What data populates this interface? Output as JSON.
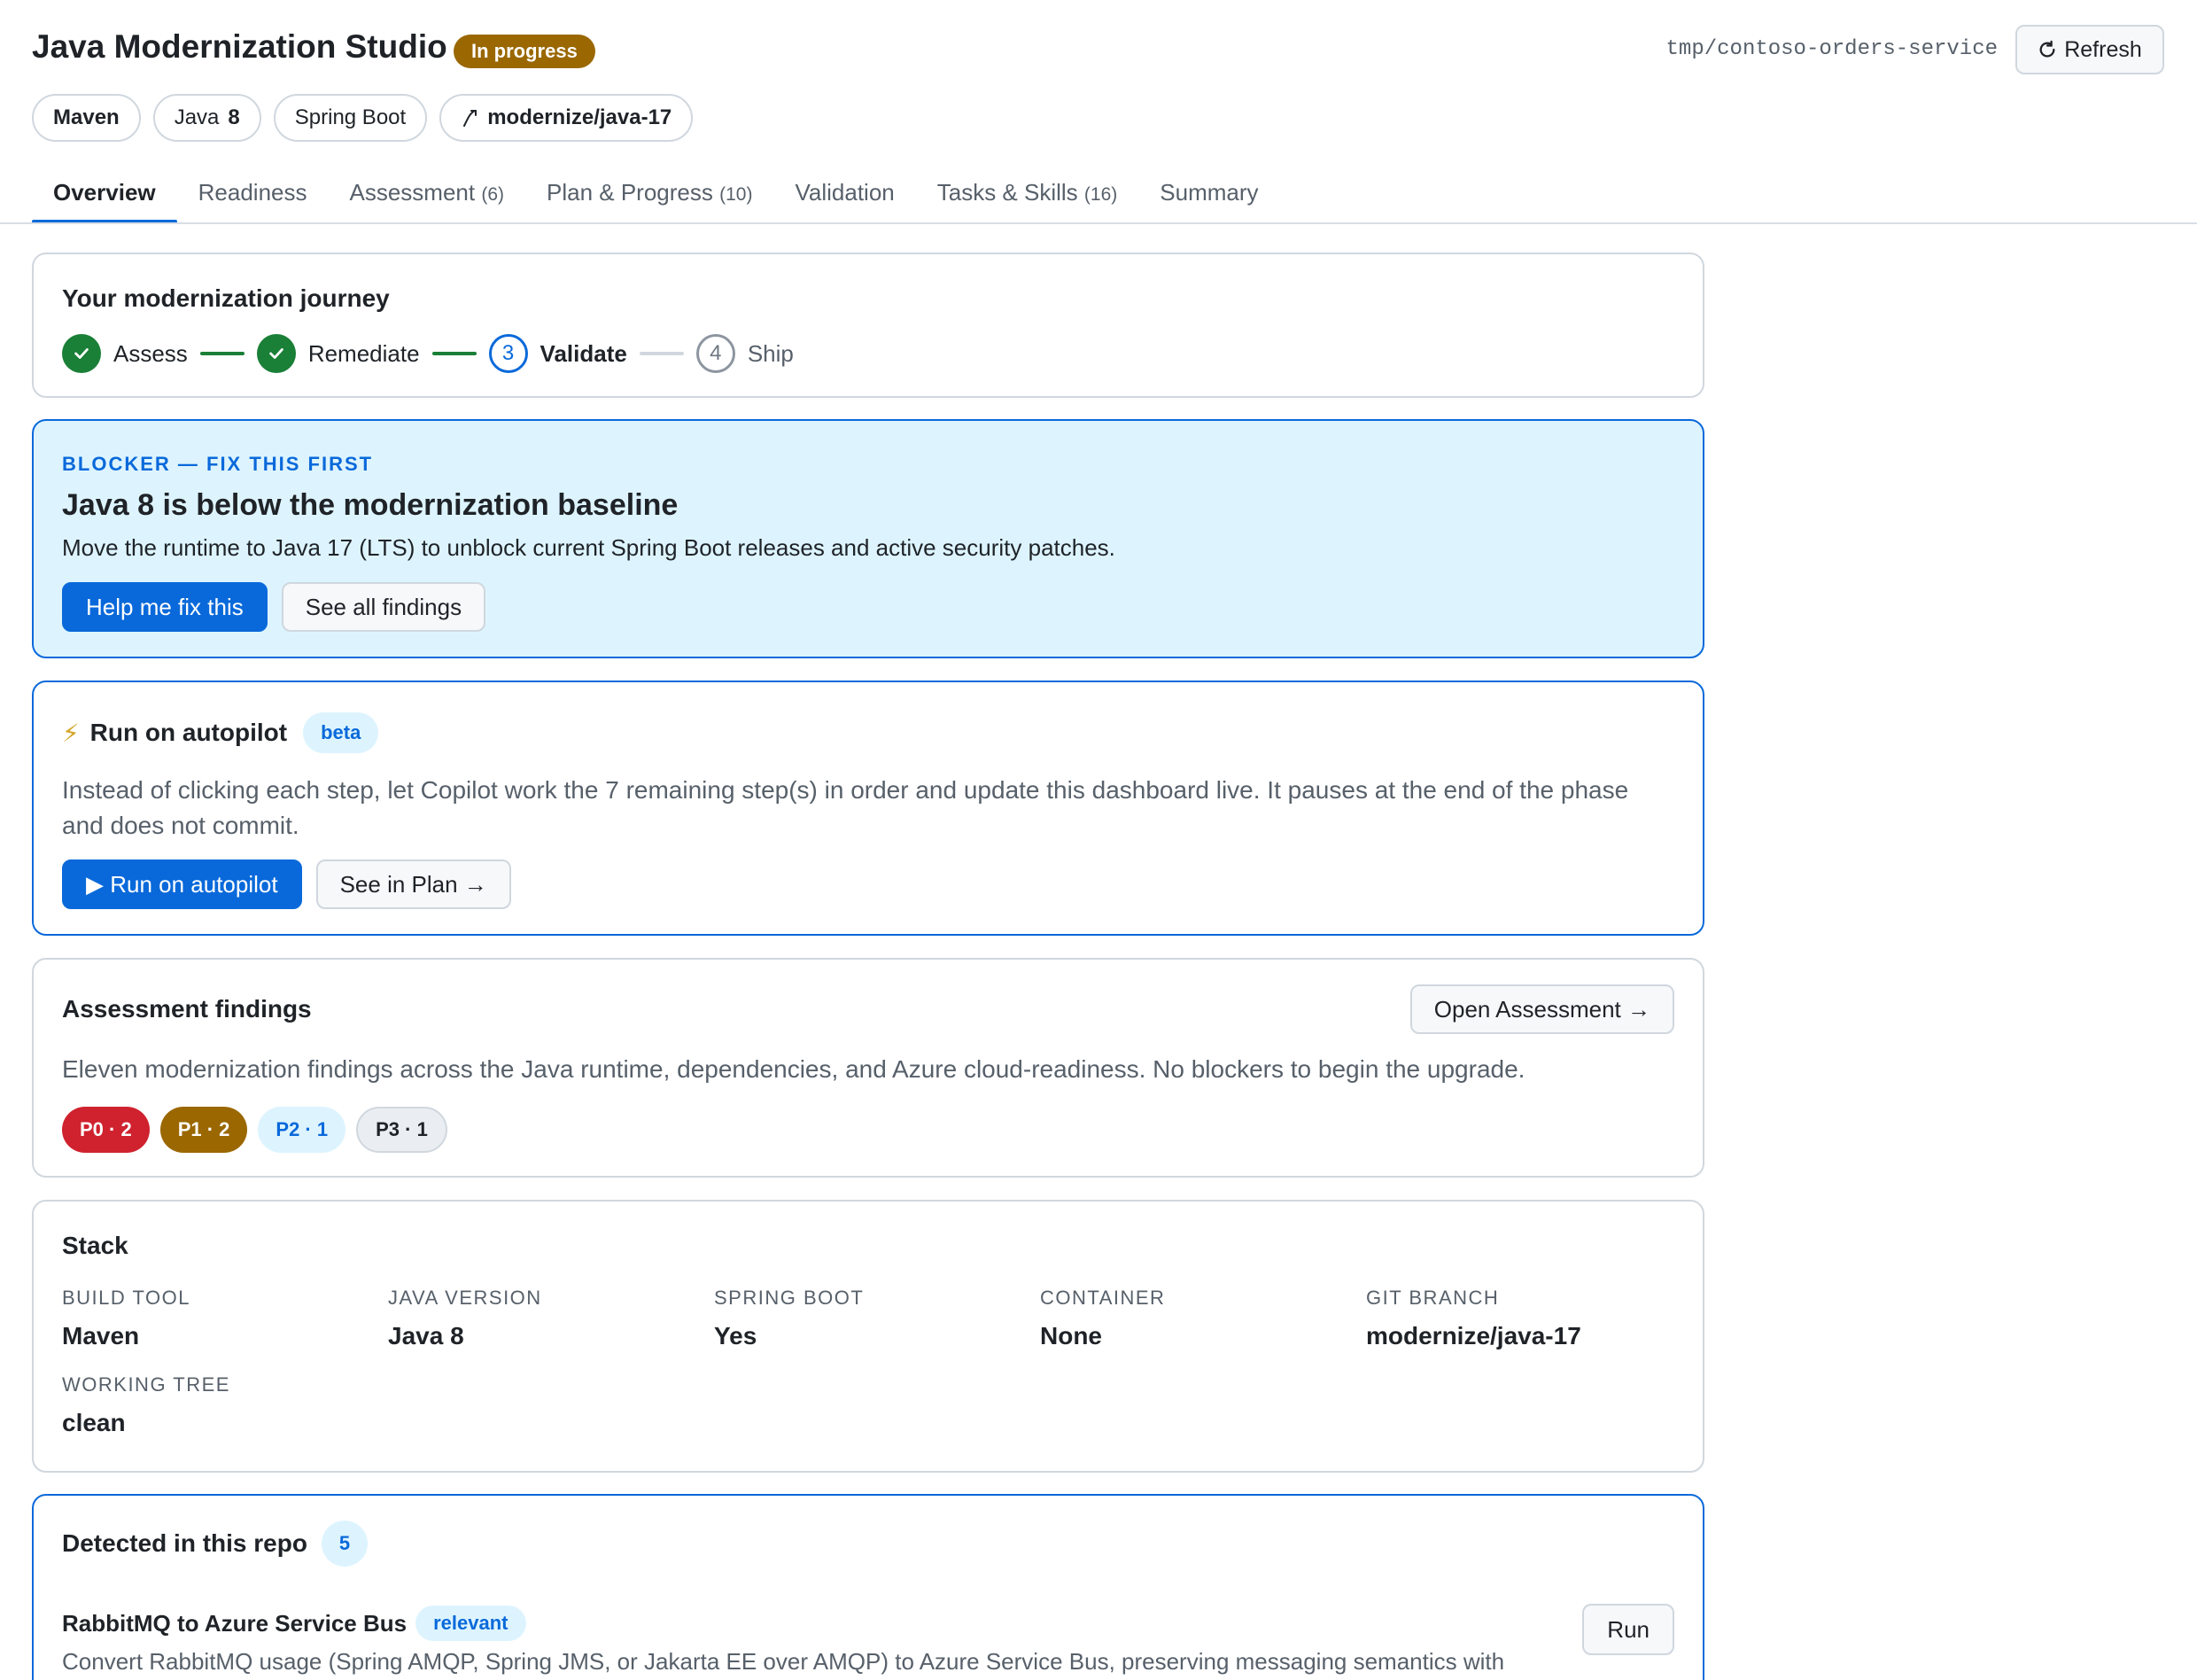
{
  "header": {
    "title": "Java Modernization Studio",
    "status": "In progress",
    "repo_path": "tmp/contoso-orders-service",
    "refresh_label": "Refresh"
  },
  "chips": {
    "build": "Maven",
    "java_prefix": "Java",
    "java_version": "8",
    "framework": "Spring Boot",
    "branch": "modernize/java-17"
  },
  "tabs": [
    {
      "label": "Overview",
      "count": ""
    },
    {
      "label": "Readiness",
      "count": ""
    },
    {
      "label": "Assessment",
      "count": "(6)"
    },
    {
      "label": "Plan & Progress",
      "count": "(10)"
    },
    {
      "label": "Validation",
      "count": ""
    },
    {
      "label": "Tasks & Skills",
      "count": "(16)"
    },
    {
      "label": "Summary",
      "count": ""
    }
  ],
  "journey": {
    "title": "Your modernization journey",
    "steps": [
      {
        "label": "Assess",
        "state": "done",
        "number": "1"
      },
      {
        "label": "Remediate",
        "state": "done",
        "number": "2"
      },
      {
        "label": "Validate",
        "state": "current",
        "number": "3"
      },
      {
        "label": "Ship",
        "state": "todo",
        "number": "4"
      }
    ]
  },
  "blocker": {
    "eyebrow": "BLOCKER — FIX THIS FIRST",
    "headline": "Java 8 is below the modernization baseline",
    "description": "Move the runtime to Java 17 (LTS) to unblock current Spring Boot releases and active security patches.",
    "primary_label": "Help me fix this",
    "secondary_label": "See all findings"
  },
  "autopilot": {
    "title": "Run on autopilot",
    "badge": "beta",
    "description": "Instead of clicking each step, let Copilot work the 7 remaining step(s) in order and update this dashboard live. It pauses at the end of the phase and does not commit.",
    "primary_label": "▶ Run on autopilot",
    "secondary_label": "See in Plan →"
  },
  "findings": {
    "title": "Assessment findings",
    "open_label": "Open Assessment →",
    "description": "Eleven modernization findings across the Java runtime, dependencies, and Azure cloud-readiness. No blockers to begin the upgrade.",
    "severities": [
      {
        "label": "P0 · 2",
        "color": "#cf222e"
      },
      {
        "label": "P1 · 2",
        "color": "#9a6700"
      },
      {
        "label": "P2 · 1",
        "color": "#ddf4ff"
      },
      {
        "label": "P3 · 1",
        "color": "#eaeef2"
      }
    ]
  },
  "stack": {
    "title": "Stack",
    "facts": [
      {
        "label": "BUILD TOOL",
        "value": "Maven"
      },
      {
        "label": "JAVA VERSION",
        "value": "Java 8"
      },
      {
        "label": "SPRING BOOT",
        "value": "Yes"
      },
      {
        "label": "CONTAINER",
        "value": "None"
      },
      {
        "label": "GIT BRANCH",
        "value": "modernize/java-17"
      },
      {
        "label": "WORKING TREE",
        "value": "clean"
      }
    ]
  },
  "detected": {
    "title": "Detected in this repo",
    "count": "5",
    "item": {
      "name": "RabbitMQ to Azure Service Bus",
      "badge": "relevant",
      "description": "Convert RabbitMQ usage (Spring AMQP, Spring JMS, or Jakarta EE over AMQP) to Azure Service Bus, preserving messaging semantics with",
      "run_label": "Run"
    }
  },
  "colors": {
    "accent": "#0969da",
    "success": "#1a7f37",
    "warning": "#9a6700",
    "danger": "#cf222e",
    "info_bg": "#ddf4ff"
  },
  "icons": {
    "refresh": "refresh-icon",
    "branch": "git-branch-icon",
    "check": "check-icon",
    "bolt": "bolt-icon"
  }
}
